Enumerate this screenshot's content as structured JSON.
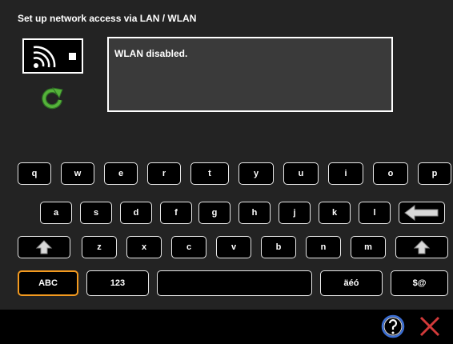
{
  "title": "Set up network access via LAN / WLAN",
  "status_message": "WLAN disabled.",
  "icons": {
    "wifi": "wifi-icon",
    "stop": "stop-icon",
    "refresh": "refresh-icon",
    "backspace": "backspace-icon",
    "shift": "shift-icon",
    "help": "help-icon",
    "close": "close-icon"
  },
  "colors": {
    "background": "#232323",
    "status_box": "#3a3a3a",
    "active_key_border": "#f39a1f",
    "refresh": "#55b23a",
    "close": "#d23a3a"
  },
  "keyboard": {
    "row1": [
      "q",
      "w",
      "e",
      "r",
      "t",
      "y",
      "u",
      "i",
      "o",
      "p"
    ],
    "row2": [
      "a",
      "s",
      "d",
      "f",
      "g",
      "h",
      "j",
      "k",
      "l"
    ],
    "row3": [
      "z",
      "x",
      "c",
      "v",
      "b",
      "n",
      "m"
    ],
    "abc": "ABC",
    "num": "123",
    "space": "",
    "accents": "äéó",
    "symbols": "$@",
    "active_mode": "ABC"
  }
}
